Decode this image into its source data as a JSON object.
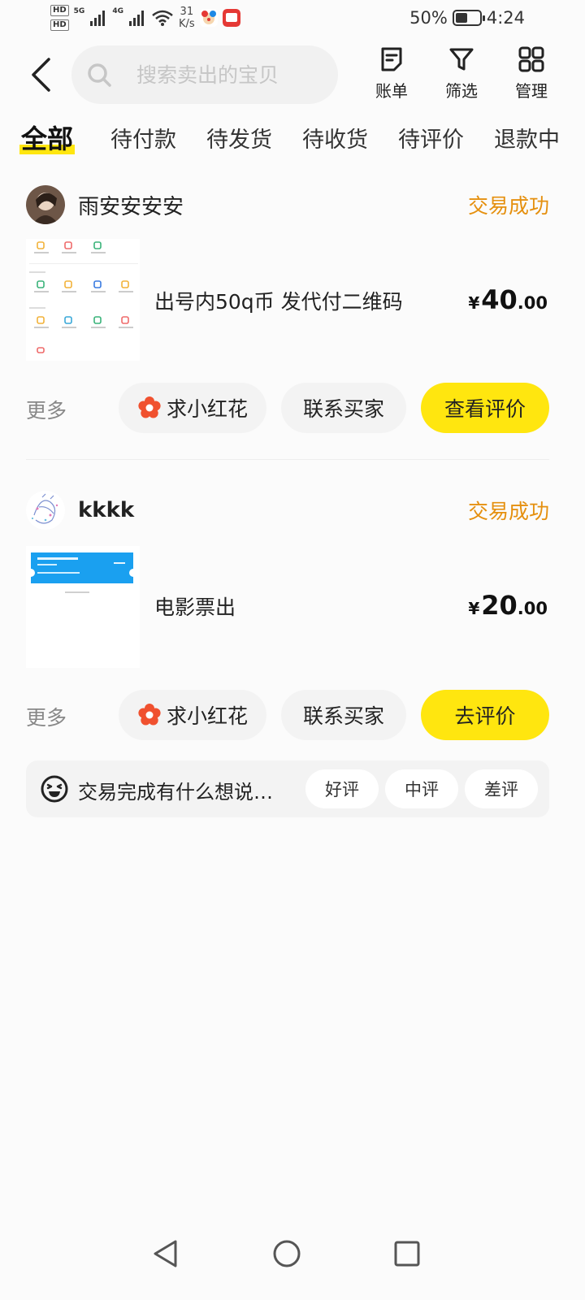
{
  "status_bar": {
    "hd1": "HD",
    "hd2": "HD",
    "net1": "5G",
    "net2": "4G",
    "speed_value": "31",
    "speed_unit": "K/s",
    "battery_percent": "50%",
    "battery_level": 0.5,
    "time": "4:24"
  },
  "header": {
    "search_placeholder": "搜索卖出的宝贝",
    "actions": [
      {
        "label": "账单",
        "icon": "bill-icon"
      },
      {
        "label": "筛选",
        "icon": "filter-icon"
      },
      {
        "label": "管理",
        "icon": "grid-icon"
      }
    ]
  },
  "tabs": [
    {
      "label": "全部",
      "active": true
    },
    {
      "label": "待付款"
    },
    {
      "label": "待发货"
    },
    {
      "label": "待收货"
    },
    {
      "label": "待评价"
    },
    {
      "label": "退款中"
    }
  ],
  "orders": [
    {
      "buyer_name": "雨安安安安",
      "status": "交易成功",
      "title": "出号内50q币 发代付二维码",
      "price_currency": "¥",
      "price_int": "40",
      "price_dec": ".00",
      "more_label": "更多",
      "flower_button": "求小红花",
      "contact_button": "联系买家",
      "primary_button": "查看评价"
    },
    {
      "buyer_name": "kkkk",
      "status": "交易成功",
      "title": "电影票出",
      "price_currency": "¥",
      "price_int": "20",
      "price_dec": ".00",
      "more_label": "更多",
      "flower_button": "求小红花",
      "contact_button": "联系买家",
      "primary_button": "去评价"
    }
  ],
  "review_bar": {
    "prompt": "交易完成有什么想说…",
    "ratings": [
      "好评",
      "中评",
      "差评"
    ]
  },
  "colors": {
    "accent_yellow": "#ffe60f",
    "status_orange": "#e5900f"
  }
}
